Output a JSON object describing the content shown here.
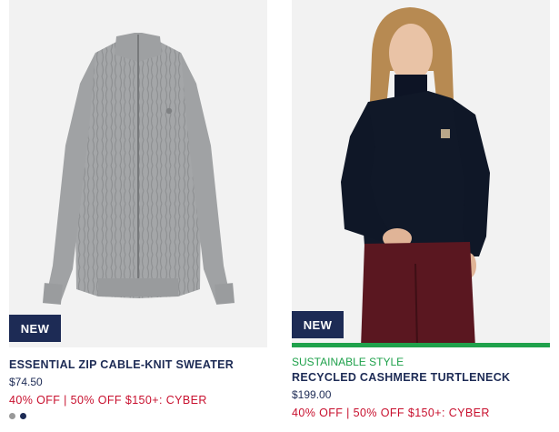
{
  "products": [
    {
      "badge": "NEW",
      "eyebrow": "",
      "name": "ESSENTIAL ZIP CABLE-KNIT SWEATER",
      "price": "$74.50",
      "promo": "40% OFF | 50% OFF $150+: CYBER",
      "swatches": [
        "#999999",
        "#1d2b55"
      ]
    },
    {
      "badge": "NEW",
      "eyebrow": "SUSTAINABLE STYLE",
      "name": "RECYCLED CASHMERE TURTLENECK",
      "price": "$199.00",
      "promo": "40% OFF | 50% OFF $150+: CYBER"
    }
  ],
  "colors": {
    "navy": "#1d2b55",
    "sale_red": "#c8102e",
    "sustainable_green": "#1fa14b"
  }
}
